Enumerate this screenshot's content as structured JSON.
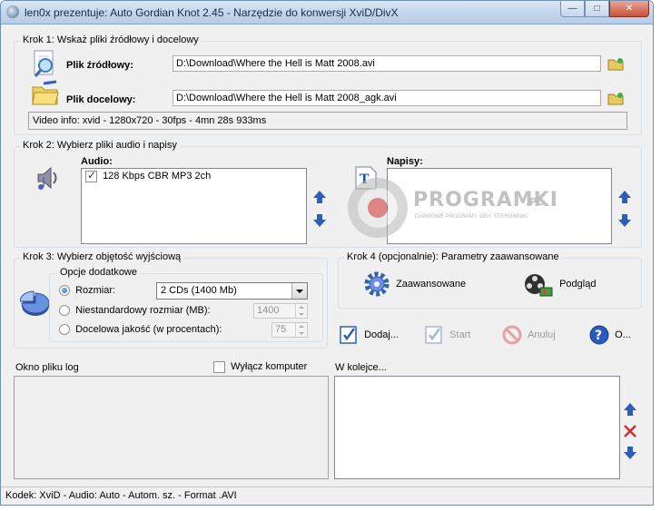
{
  "window": {
    "title": "len0x prezentuje: Auto Gordian Knot 2.45 - Narzędzie do konwersji XviD/DivX",
    "controls": [
      "minimize",
      "maximize",
      "close"
    ]
  },
  "step1": {
    "legend": "Krok 1: Wskaż pliki źródłowy i docelowy",
    "source_label": "Plik źródłowy:",
    "source_value": "D:\\Download\\Where the Hell is Matt 2008.avi",
    "dest_label": "Plik docelowy:",
    "dest_value": "D:\\Download\\Where the Hell is Matt 2008_agk.avi",
    "video_info": "Video info:  xvid - 1280x720 - 30fps - 4mn 28s 933ms"
  },
  "step2": {
    "legend": "Krok 2: Wybierz pliki audio i napisy",
    "audio_label": "Audio:",
    "audio_items": [
      {
        "label": "128 Kbps CBR MP3 2ch",
        "checked": true
      }
    ],
    "subs_label": "Napisy:"
  },
  "watermark": {
    "brand": "PROGRAMKI",
    "suffix": ".PL",
    "tagline": "DARMOWE PROGRAMY, GRY, STEROWNIKI"
  },
  "step3": {
    "legend": "Krok 3: Wybierz objętość wyjściową",
    "options_legend": "Opcje dodatkowe",
    "size_label": "Rozmiar:",
    "size_value": "2 CDs (1400 Mb)",
    "custom_label": "Niestandardowy rozmiar (MB):",
    "custom_value": "1400",
    "quality_label": "Docelowa jakość (w procentach):",
    "quality_value": "75"
  },
  "step4": {
    "legend": "Krok 4 (opcjonalnie): Parametry zaawansowane",
    "advanced_label": "Zaawansowane",
    "preview_label": "Podgląd"
  },
  "actions": {
    "add": "Dodaj...",
    "start": "Start",
    "cancel": "Anuluj",
    "about": "O..."
  },
  "log": {
    "label": "Okno pliku log",
    "shutdown_label": "Wyłącz komputer"
  },
  "queue": {
    "label": "W kolejce..."
  },
  "statusbar": {
    "text": "Kodek: XviD -  Audio: Auto -  Autom. sz. - Format .AVI"
  },
  "colors": {
    "window_bg": "#f0f0f0",
    "arrow_blue": "#2e5db8",
    "delete_red": "#d03030"
  }
}
